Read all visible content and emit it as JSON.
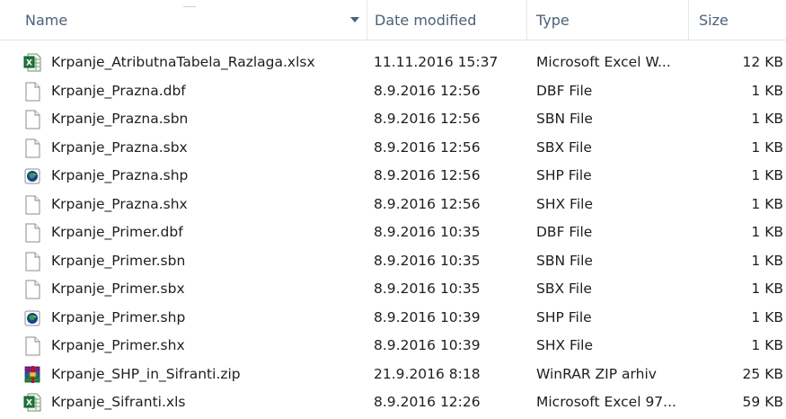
{
  "columns": {
    "name": "Name",
    "date": "Date modified",
    "type": "Type",
    "size": "Size"
  },
  "files": [
    {
      "name": "Krpanje_AtributnaTabela_Razlaga.xlsx",
      "date": "11.11.2016 15:37",
      "type": "Microsoft Excel W...",
      "size": "12 KB",
      "icon": "excel-icon"
    },
    {
      "name": "Krpanje_Prazna.dbf",
      "date": "8.9.2016 12:56",
      "type": "DBF File",
      "size": "1 KB",
      "icon": "file-icon"
    },
    {
      "name": "Krpanje_Prazna.sbn",
      "date": "8.9.2016 12:56",
      "type": "SBN File",
      "size": "1 KB",
      "icon": "file-icon"
    },
    {
      "name": "Krpanje_Prazna.sbx",
      "date": "8.9.2016 12:56",
      "type": "SBX File",
      "size": "1 KB",
      "icon": "file-icon"
    },
    {
      "name": "Krpanje_Prazna.shp",
      "date": "8.9.2016 12:56",
      "type": "SHP File",
      "size": "1 KB",
      "icon": "shp-icon"
    },
    {
      "name": "Krpanje_Prazna.shx",
      "date": "8.9.2016 12:56",
      "type": "SHX File",
      "size": "1 KB",
      "icon": "file-icon"
    },
    {
      "name": "Krpanje_Primer.dbf",
      "date": "8.9.2016 10:35",
      "type": "DBF File",
      "size": "1 KB",
      "icon": "file-icon"
    },
    {
      "name": "Krpanje_Primer.sbn",
      "date": "8.9.2016 10:35",
      "type": "SBN File",
      "size": "1 KB",
      "icon": "file-icon"
    },
    {
      "name": "Krpanje_Primer.sbx",
      "date": "8.9.2016 10:35",
      "type": "SBX File",
      "size": "1 KB",
      "icon": "file-icon"
    },
    {
      "name": "Krpanje_Primer.shp",
      "date": "8.9.2016 10:39",
      "type": "SHP File",
      "size": "1 KB",
      "icon": "shp-icon"
    },
    {
      "name": "Krpanje_Primer.shx",
      "date": "8.9.2016 10:39",
      "type": "SHX File",
      "size": "1 KB",
      "icon": "file-icon"
    },
    {
      "name": "Krpanje_SHP_in_Sifranti.zip",
      "date": "21.9.2016 8:18",
      "type": "WinRAR ZIP arhiv",
      "size": "25 KB",
      "icon": "winrar-icon"
    },
    {
      "name": "Krpanje_Sifranti.xls",
      "date": "8.9.2016 12:26",
      "type": "Microsoft Excel 97...",
      "size": "59 KB",
      "icon": "excel-icon"
    }
  ],
  "colors": {
    "header_text": "#4c607a",
    "excel_green": "#1f7a3a",
    "winrar_red": "#b0172c"
  }
}
